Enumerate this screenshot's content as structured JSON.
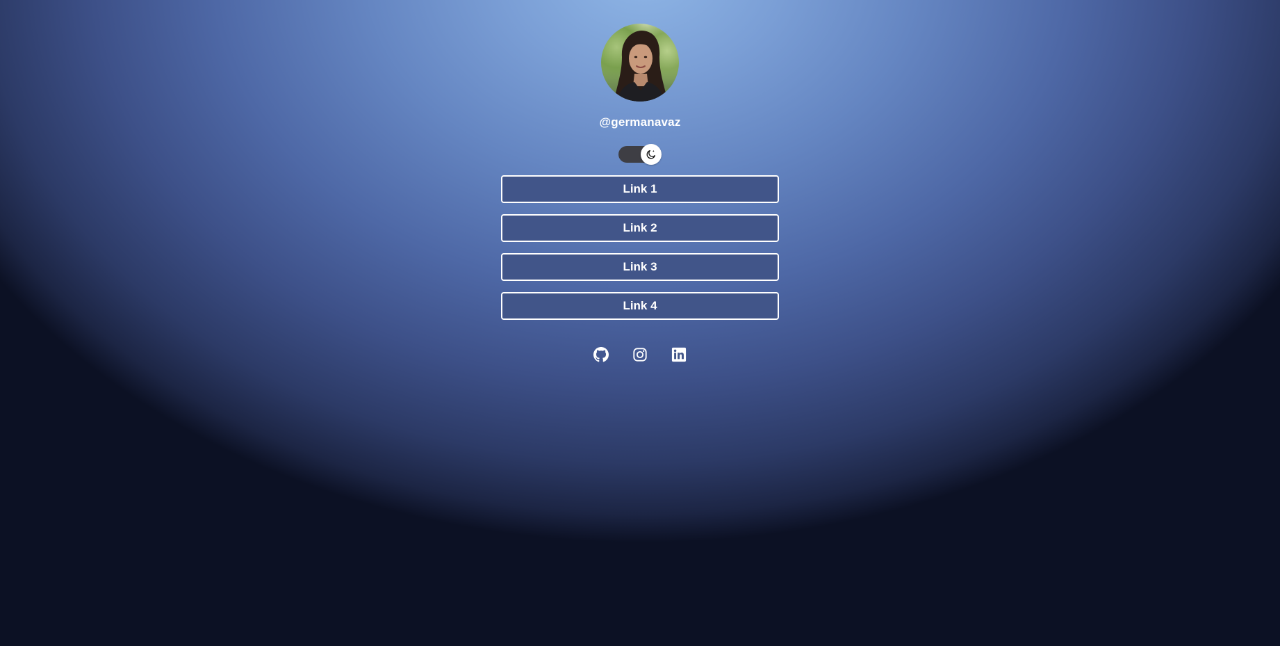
{
  "profile": {
    "username": "@germanavaz",
    "avatar_icon": "profile-photo"
  },
  "theme_toggle": {
    "icon": "moon-icon",
    "state": "dark"
  },
  "links": [
    {
      "label": "Link 1"
    },
    {
      "label": "Link 2"
    },
    {
      "label": "Link 3"
    },
    {
      "label": "Link 4"
    }
  ],
  "socials": [
    {
      "name": "github",
      "icon": "github-icon"
    },
    {
      "name": "instagram",
      "icon": "instagram-icon"
    },
    {
      "name": "linkedin",
      "icon": "linkedin-icon"
    }
  ],
  "colors": {
    "button_bg": "#415589",
    "button_border": "#ffffff",
    "toggle_track": "#3e3e44",
    "text": "#ffffff"
  }
}
